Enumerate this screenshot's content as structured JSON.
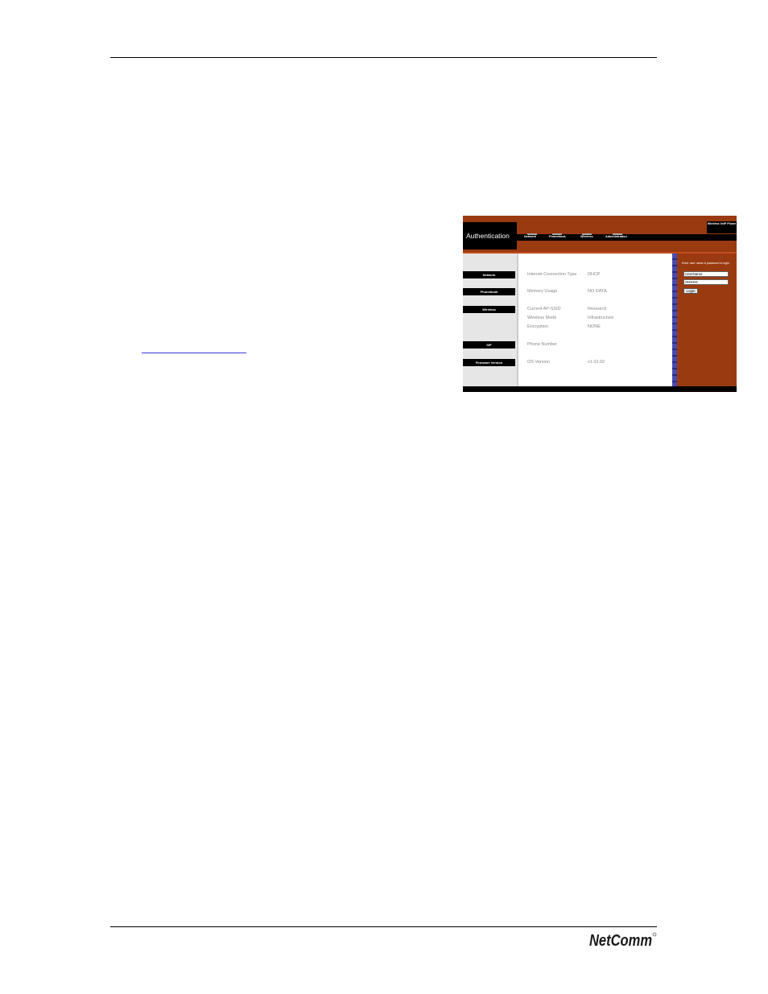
{
  "logo": {
    "text": "NetComm"
  },
  "screenshot": {
    "header": {
      "title": "Authentication",
      "product": "Wireless VoIP Phone"
    },
    "nav": [
      "Network",
      "Phonebook",
      "Wireless",
      "Administration"
    ],
    "sidebar": [
      "Network",
      "Phonebook",
      "Wireless",
      "SIP",
      "Firmware Version"
    ],
    "info": [
      {
        "label": "Internet Connection Type",
        "value": "DHCP"
      },
      {
        "label": "Memory Usage",
        "value": "NO DATA"
      },
      {
        "label": "Current AP-SSID",
        "value": "Research"
      },
      {
        "label": "Wireless Mode",
        "value": "Infrastructure"
      },
      {
        "label": "Encryption",
        "value": "NONE"
      },
      {
        "label": "Phone Number",
        "value": ""
      },
      {
        "label": "OS Version",
        "value": "v1.02.02"
      }
    ],
    "login": {
      "prompt": "Enter user name & password to login",
      "username": "UserName",
      "password": "••••••••••",
      "button": "Login"
    },
    "colors": {
      "brand": "#9a3a10",
      "nav": "#000000",
      "divider": "#4a4ab0"
    }
  }
}
